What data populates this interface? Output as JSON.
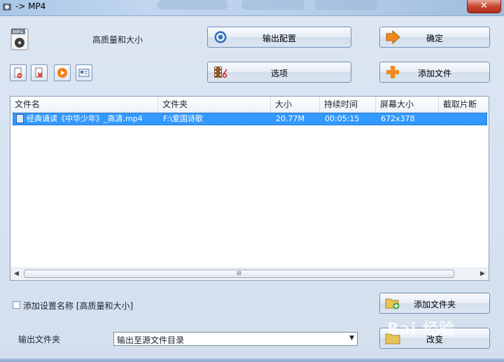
{
  "window": {
    "title": "-> MP4",
    "close_glyph": "✕"
  },
  "profile": {
    "quality_label": "高质量和大小",
    "icon_text": "MP4"
  },
  "buttons": {
    "output_config": "输出配置",
    "confirm": "确定",
    "options": "选项",
    "add_file": "添加文件",
    "add_folder": "添加文件夹",
    "change": "改变"
  },
  "toolbar": {
    "icons": [
      "remove-file-icon",
      "clear-list-icon",
      "play-icon",
      "media-info-icon"
    ]
  },
  "file_list": {
    "columns": [
      "文件名",
      "文件夹",
      "大小",
      "持续时间",
      "屏幕大小",
      "截取片断"
    ],
    "rows": [
      {
        "name": "经典诵读《中华少年》_高清.mp4",
        "folder": "F:\\爱国诗歌",
        "size": "20.77M",
        "duration": "00:05:15",
        "screen": "672x378",
        "clip": ""
      }
    ],
    "scroll_grip": "III"
  },
  "options": {
    "add_setting_name_label": "添加设置名称 [高质量和大小]",
    "output_folder_label": "输出文件夹",
    "output_folder_value": "输出至源文件目录"
  },
  "watermark": "Bai 经验",
  "colors": {
    "selection": "#3399ff",
    "accent_orange": "#f08a1c"
  }
}
